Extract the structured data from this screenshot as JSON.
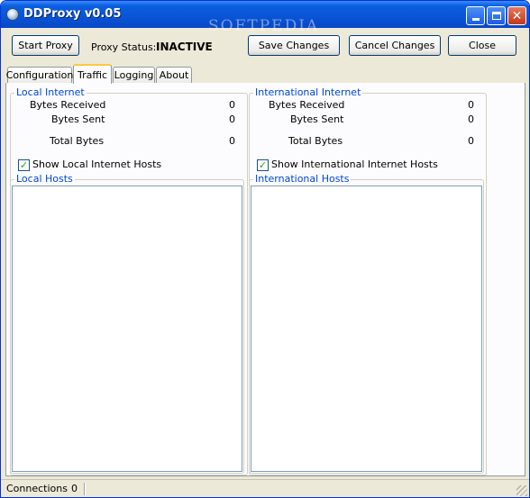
{
  "window": {
    "title": "DDProxy v0.05",
    "watermark": "SOFTPEDIA"
  },
  "toolbar": {
    "start_proxy": "Start Proxy",
    "proxy_status_label": "Proxy Status:",
    "proxy_status_value": "INACTIVE",
    "save_changes": "Save Changes",
    "cancel_changes": "Cancel Changes",
    "close": "Close"
  },
  "tabs": [
    {
      "label": "Configuration",
      "active": false
    },
    {
      "label": "Traffic",
      "active": true
    },
    {
      "label": "Logging",
      "active": false
    },
    {
      "label": "About",
      "active": false
    }
  ],
  "local": {
    "group_title": "Local Internet",
    "bytes_received_label": "Bytes Received",
    "bytes_received": "0",
    "bytes_sent_label": "Bytes Sent",
    "bytes_sent": "0",
    "total_bytes_label": "Total Bytes",
    "total_bytes": "0",
    "show_hosts_label": "Show Local Internet Hosts",
    "show_hosts_checked": true,
    "hosts_title": "Local Hosts",
    "hosts": []
  },
  "international": {
    "group_title": "International Internet",
    "bytes_received_label": "Bytes Received",
    "bytes_received": "0",
    "bytes_sent_label": "Bytes Sent",
    "bytes_sent": "0",
    "total_bytes_label": "Total Bytes",
    "total_bytes": "0",
    "show_hosts_label": "Show International Internet Hosts",
    "show_hosts_checked": true,
    "hosts_title": "International Hosts",
    "hosts": []
  },
  "statusbar": {
    "connections_label": "Connections",
    "connections_value": "0"
  }
}
